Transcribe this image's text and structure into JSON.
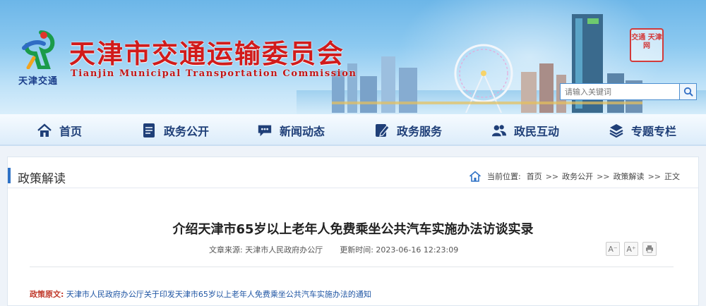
{
  "header": {
    "logo_caption": "天津交通",
    "title": "天津市交通运输委员会",
    "subtitle": "Tianjin Municipal Transportation Commission",
    "seal_text": "交通 天津 网",
    "search_placeholder": "请输入关键词"
  },
  "nav": {
    "items": [
      {
        "label": "首页",
        "icon": "home-icon"
      },
      {
        "label": "政务公开",
        "icon": "document-icon"
      },
      {
        "label": "新闻动态",
        "icon": "chat-icon"
      },
      {
        "label": "政务服务",
        "icon": "edit-icon"
      },
      {
        "label": "政民互动",
        "icon": "users-icon"
      },
      {
        "label": "专题专栏",
        "icon": "layers-icon"
      }
    ]
  },
  "section": {
    "title": "政策解读",
    "breadcrumb_label": "当前位置:",
    "breadcrumb": [
      "首页",
      "政务公开",
      "政策解读",
      "正文"
    ],
    "breadcrumb_sep": ">>"
  },
  "article": {
    "title": "介绍天津市65岁以上老年人免费乘坐公共汽车实施办法访谈实录",
    "source": "文章来源:  天津市人民政府办公厅",
    "updated": "更新时间:  2023-06-16 12:23:09",
    "font_up": "A⁺",
    "font_down": "A⁻",
    "policy_label": "政策原文:",
    "policy_link": "天津市人民政府办公厅关于印发天津市65岁以上老年人免费乘坐公共汽车实施办法的通知"
  },
  "colors": {
    "title_red": "#d11b1b",
    "nav_text": "#1f3f78",
    "accent_blue": "#2f72c6"
  }
}
